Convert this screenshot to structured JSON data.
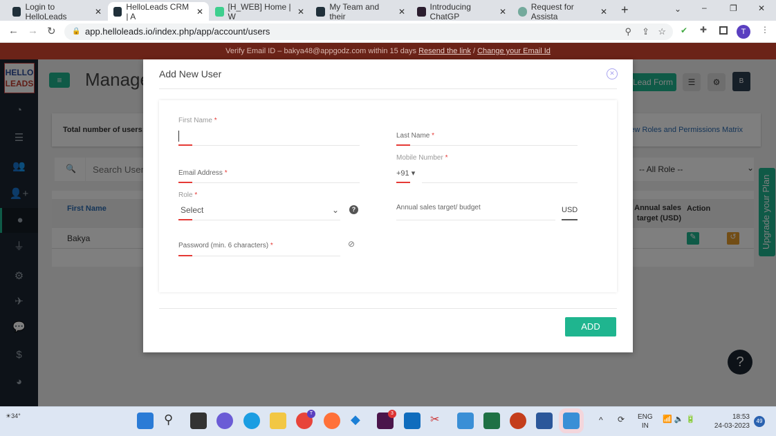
{
  "browser": {
    "tabs": [
      {
        "label": "Login to HelloLeads",
        "active": false
      },
      {
        "label": "HelloLeads CRM | A",
        "active": true
      },
      {
        "label": "[H_WEB] Home | W",
        "active": false
      },
      {
        "label": "My Team and their",
        "active": false
      },
      {
        "label": "Introducing ChatGP",
        "active": false
      },
      {
        "label": "Request for Assista",
        "active": false
      }
    ],
    "url": "app.helloleads.io/index.php/app/account/users",
    "profile_initial": "T"
  },
  "banner": {
    "prefix": "Verify Email ID  –  bakya48@appgodz.com within 15 days ",
    "resend": "Resend the link",
    "sep": " / ",
    "change": "Change your Email Id"
  },
  "app": {
    "logo_top": "HELLO",
    "logo_bottom": "LEADS",
    "page_title": "Manage",
    "lead_form": "Lead Form",
    "user_initial": "B",
    "total_users_label": "Total number of users:",
    "roles_link": "View Roles and Permissions Matrix",
    "search_placeholder": "Search User",
    "role_filter": "-- All Role --",
    "table": {
      "headers": [
        "First Name",
        "Annual sales target (USD)",
        "Action"
      ],
      "rows": [
        [
          "Bakya",
          "",
          ""
        ]
      ]
    },
    "upgrade": "Upgrade your Plan",
    "help": "?"
  },
  "modal": {
    "title": "Add New User",
    "first_name": "First Name",
    "last_name": "Last Name",
    "email": "Email Address",
    "mobile": "Mobile Number",
    "country_code": "+91",
    "role": "Role",
    "role_value": "Select",
    "target": "Annual sales target/ budget",
    "currency": "USD",
    "password": "Password (min. 6 characters)",
    "add": "ADD",
    "required": "*"
  },
  "taskbar": {
    "weather": "34°",
    "lang": "ENG",
    "region": "IN",
    "time": "18:53",
    "date": "24-03-2023",
    "notifications": "49",
    "chrome_badge": "T",
    "slack_badge": "3"
  },
  "colors": {
    "accent": "#1fb58f",
    "banner": "#6b2318",
    "required": "#e53935"
  }
}
